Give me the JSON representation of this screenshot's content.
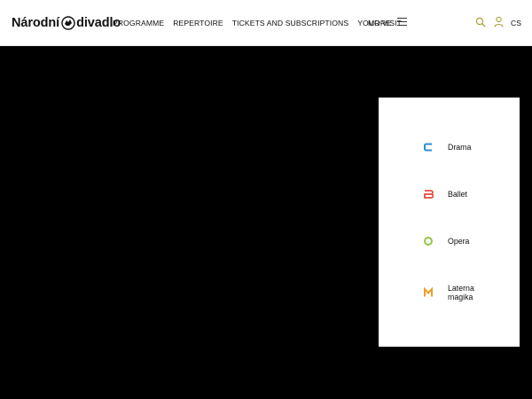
{
  "header": {
    "logo_left": "Národní",
    "logo_right": "divadlo",
    "nav": [
      {
        "label": "PROGRAMME"
      },
      {
        "label": "REPERTOIRE"
      },
      {
        "label": "TICKETS AND SUBSCRIPTIONS"
      },
      {
        "label": "YOUR VISIT"
      }
    ],
    "more_label": "MORE",
    "lang_label": "CS",
    "icons": {
      "search": "search-icon",
      "user": "user-icon",
      "menu": "hamburger-menu-icon"
    },
    "accent": "#a8a032"
  },
  "ensembles": [
    {
      "label": "Drama",
      "icon": "drama-c-icon",
      "color": "#2b8fd0"
    },
    {
      "label": "Ballet",
      "icon": "ballet-b-icon",
      "color": "#e44b3d"
    },
    {
      "label": "Opera",
      "icon": "opera-o-icon",
      "color": "#8cc63f"
    },
    {
      "label": "Laterna magika",
      "icon": "laterna-m-icon",
      "color": "#f29a1b"
    }
  ]
}
